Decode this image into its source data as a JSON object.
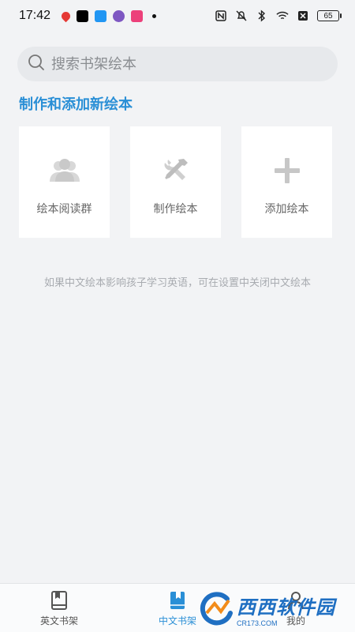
{
  "status_bar": {
    "time": "17:42",
    "battery": "65",
    "notif_colors": [
      "#e53935",
      "#000000",
      "#2196f3",
      "#7e57c2",
      "#ec407a"
    ]
  },
  "search": {
    "placeholder": "搜索书架绘本"
  },
  "section": {
    "title": "制作和添加新绘本"
  },
  "cards": [
    {
      "label": "绘本阅读群",
      "icon": "users-icon"
    },
    {
      "label": "制作绘本",
      "icon": "tools-icon"
    },
    {
      "label": "添加绘本",
      "icon": "plus-icon"
    }
  ],
  "hint": "如果中文绘本影响孩子学习英语，可在设置中关闭中文绘本",
  "tabs": [
    {
      "label": "英文书架",
      "icon": "book-outline-icon",
      "active": false
    },
    {
      "label": "中文书架",
      "icon": "book-filled-icon",
      "active": true
    },
    {
      "label": "我的",
      "icon": "person-icon",
      "active": false
    }
  ],
  "watermark": {
    "text": "西西软件园",
    "sub": "CR173.COM"
  },
  "colors": {
    "accent": "#2a8fd6",
    "background": "#f2f3f5"
  }
}
